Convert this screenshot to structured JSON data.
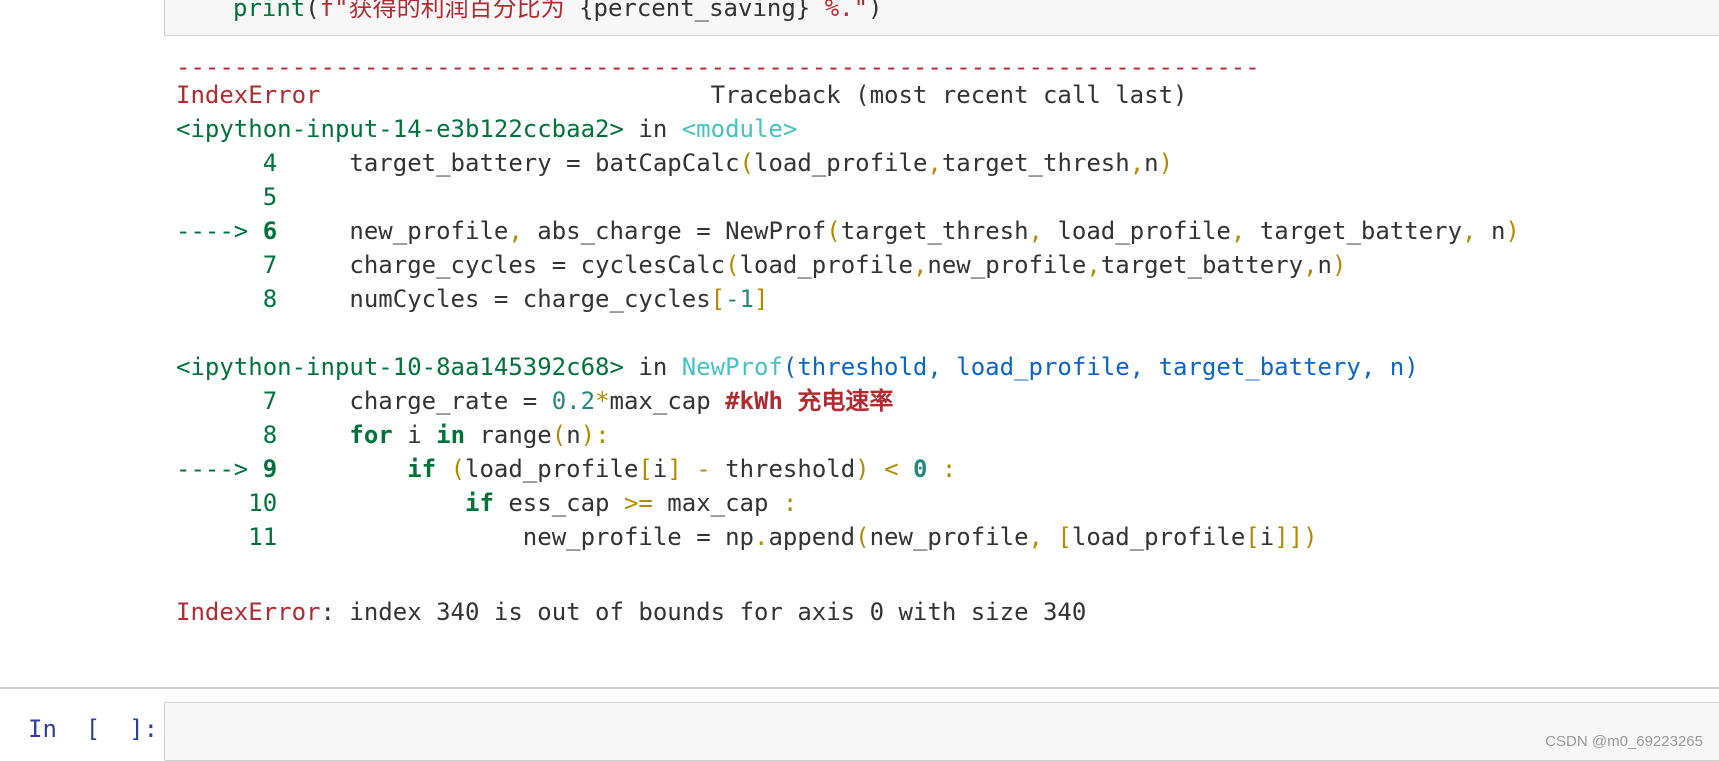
{
  "prev_cell": {
    "line_func": "print",
    "line_open": "(",
    "line_fstring": "f\"获得的利润百分比为 ",
    "line_var": "{percent_saving}",
    "line_tail": " %.\"",
    "line_close": ")"
  },
  "traceback": {
    "separator": "---------------------------------------------------------------------------",
    "error_name": "IndexError",
    "header_right": "Traceback (most recent call last)",
    "frame1": {
      "file": "<ipython-input-14-e3b122ccbaa2>",
      "in_word": " in ",
      "scope": "<module>",
      "lines": [
        {
          "arrow": "",
          "num": "4",
          "code_a": "target_battery = batCapCalc",
          "p1": "(",
          "code_b": "load_profile",
          "c1": ",",
          "code_c": "target_thresh",
          "c2": ",",
          "code_d": "n",
          "p2": ")"
        },
        {
          "arrow": "",
          "num": "5"
        },
        {
          "arrow": "---->",
          "num": "6",
          "code_a": "new_profile",
          "c0": ",",
          "code_b": " abs_charge = NewProf",
          "p1": "(",
          "code_c": "target_thresh",
          "c1": ",",
          "code_d": " load_profile",
          "c2": ",",
          "code_e": " target_battery",
          "c3": ",",
          "code_f": " n",
          "p2": ")"
        },
        {
          "arrow": "",
          "num": "7",
          "code_a": "charge_cycles = cyclesCalc",
          "p1": "(",
          "code_b": "load_profile",
          "c1": ",",
          "code_c": "new_profile",
          "c2": ",",
          "code_d": "target_battery",
          "c3": ",",
          "code_e": "n",
          "p2": ")"
        },
        {
          "arrow": "",
          "num": "8",
          "code_a": "numCycles = charge_cycles",
          "b1": "[",
          "neg": "-1",
          "b2": "]"
        }
      ]
    },
    "frame2": {
      "file": "<ipython-input-10-8aa145392c68>",
      "in_word": " in ",
      "func": "NewProf",
      "args": "(threshold, load_profile, target_battery, n)",
      "lines": [
        {
          "arrow": "",
          "num": "7",
          "code_a": "charge_rate = ",
          "numval": "0.2",
          "op": "*",
          "code_b": "max_cap ",
          "comment": "#kWh 充电速率"
        },
        {
          "arrow": "",
          "num": "8",
          "kw1": "for",
          "code_a": " i ",
          "kw2": "in",
          "code_b": " range",
          "p1": "(",
          "code_c": "n",
          "p2": ")",
          "colon": ":"
        },
        {
          "arrow": "---->",
          "num": "9",
          "kw1": "if",
          "code_a": " ",
          "p1": "(",
          "code_b": "load_profile",
          "b1": "[",
          "code_c": "i",
          "b2": "]",
          "op": " - ",
          "code_d": "threshold",
          "p2": ")",
          "op2": " < ",
          "numval": "0",
          "colon": " :"
        },
        {
          "arrow": "",
          "num": "10",
          "kw1": "if",
          "code_a": " ess_cap ",
          "op": ">=",
          "code_b": " max_cap ",
          "colon": ":"
        },
        {
          "arrow": "",
          "num": "11",
          "code_a": "new_profile = np",
          "dot": ".",
          "code_b": "append",
          "p1": "(",
          "code_c": "new_profile",
          "c1": ",",
          "b1": " [",
          "code_d": "load_profile",
          "b2": "[",
          "code_e": "i",
          "b3": "]]",
          "p2": ")"
        }
      ]
    },
    "final_error_name": "IndexError",
    "final_message": ": index 340 is out of bounds for axis 0 with size 340"
  },
  "next_cell": {
    "prompt": "In  [  ]:",
    "input_value": ""
  },
  "watermark": "CSDN @m0_69223265",
  "colors": {
    "error_red": "#b22b31",
    "green": "#00733b",
    "cyan": "#45c3c0",
    "blue": "#0b65c8",
    "gold": "#b58900",
    "prompt_blue": "#303f9f"
  }
}
